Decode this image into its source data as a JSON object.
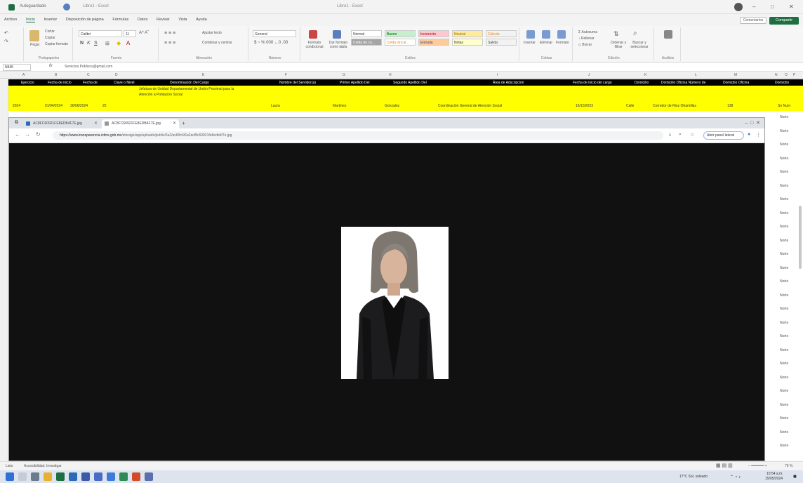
{
  "excel": {
    "autosave_label": "Autoguardado",
    "doc_name": "Libro1 - Excel",
    "window_title": "Libro1 - Excel",
    "user_name": "",
    "tabs": [
      "Archivo",
      "Inicio",
      "Insertar",
      "Disposición de página",
      "Fórmulas",
      "Datos",
      "Revisar",
      "Vista",
      "Ayuda"
    ],
    "active_tab": "Inicio",
    "comments_label": "Comentarios",
    "share_label": "Compartir",
    "ribbon": {
      "paste": "Pegar",
      "cut": "Cortar",
      "copy": "Copiar",
      "format_painter": "Copiar formato",
      "clipboard": "Portapapeles",
      "font_name": "Calibri",
      "font_size": "11",
      "font_group": "Fuente",
      "wrap_text": "Ajustar texto",
      "merge_center": "Combinar y centrar",
      "alignment_group": "Alineación",
      "number_format": "General",
      "number_group": "Número",
      "cond_format": "Formato condicional",
      "format_as_table": "Dar formato como tabla",
      "styles": [
        {
          "label": "Normal",
          "bg": "#ffffff",
          "fg": "#333333"
        },
        {
          "label": "Bueno",
          "bg": "#c6efce",
          "fg": "#006100"
        },
        {
          "label": "Incorrecto",
          "bg": "#ffc7ce",
          "fg": "#9c0006"
        },
        {
          "label": "Neutral",
          "bg": "#ffeb9c",
          "fg": "#9c6500"
        },
        {
          "label": "Cálculo",
          "bg": "#f2f2f2",
          "fg": "#fa7d00"
        },
        {
          "label": "Celda de co...",
          "bg": "#a5a5a5",
          "fg": "#ffffff"
        },
        {
          "label": "Celda vincul...",
          "bg": "#ffffff",
          "fg": "#fa7d00"
        },
        {
          "label": "Entrada",
          "bg": "#ffcc99",
          "fg": "#3f3f76"
        },
        {
          "label": "Notas",
          "bg": "#ffffcc",
          "fg": "#333333"
        },
        {
          "label": "Salida",
          "bg": "#f2f2f2",
          "fg": "#3f3f3f"
        }
      ],
      "styles_group": "Estilos",
      "insert": "Insertar",
      "delete": "Eliminar",
      "format": "Formato",
      "cells_group": "Celdas",
      "autosum": "Autosuma",
      "fill": "Rellenar",
      "clear": "Borrar",
      "sort_filter": "Ordenar y filtrar",
      "find_select": "Buscar y seleccionar",
      "editing_group": "Edición",
      "analysis_group": "Análisis"
    },
    "name_box": "N545",
    "formula_value": "Servicios.Públicos@gmail.com",
    "columns": [
      "A",
      "B",
      "C",
      "D",
      "E",
      "F",
      "G",
      "H",
      "I",
      "J",
      "K",
      "L",
      "M",
      "N",
      "O",
      "P"
    ],
    "headers": [
      "Ejercicio",
      "Fecha de inicio",
      "Fecha de",
      "Clave o Nivel",
      "Denominación Del Cargo",
      "Nombre del Servidor(a)",
      "Primer Apellido Del",
      "Segundo Apellido Del",
      "Área de Adscripción",
      "Fecha de inicio del cargo",
      "Domicilio",
      "Domicilio Oficina Número de",
      "Domicilio Oficina",
      "Domicilio"
    ],
    "row_text_1": "Jefatura de Unidad Departamental de Unión Proximal para la",
    "row_text_2": "Atención a Población Social",
    "row_cells": [
      "2024",
      "01/04/2024",
      "30/06/2024",
      "25",
      "Laura",
      "Martínez",
      "Gonzalez",
      "Coordinación General de Atención Social",
      "16/10/2023",
      "Calle",
      "Corredor de Rioz Otramillas",
      "138",
      "Sn Num"
    ],
    "right_col_cells": [
      "Norte",
      "Norte",
      "Norte",
      "Norte",
      "Norte",
      "Norte",
      "Norte",
      "Norte",
      "Norte",
      "Norte",
      "Norte",
      "Norte",
      "Norte",
      "Norte",
      "Norte",
      "Norte",
      "Norte",
      "Norte",
      "Norte",
      "Norte",
      "Norte",
      "Norte",
      "Norte",
      "Norte",
      "Norte"
    ],
    "status": {
      "sheet_tab": "Accesibilidad: Investigar",
      "zoom": "70 %"
    }
  },
  "browser": {
    "tabs": [
      {
        "label": "AC8FC60921FE8EDB4F7E.jpg",
        "active": false
      },
      {
        "label": "AC8FC60921FE8EDB4F7E.jpg",
        "active": true
      }
    ],
    "url_host": "https://www.transparencia.cdmx.gob.mx",
    "url_path": "/storage/app/uploads/public/6a2/ac8/fc6/6a2ac8fc60921fe8edb4f7e.jpg",
    "side_panel_label": "Abrir panel lateral"
  },
  "taskbar": {
    "weather": "17°C Sol, soleado",
    "time": "10:54 a.m.",
    "date": "15/05/2024"
  },
  "colors": {
    "excel_green": "#1d6f42",
    "header_row": "#000000",
    "highlight_row": "#ffff00",
    "viewer_bg": "#111111"
  }
}
